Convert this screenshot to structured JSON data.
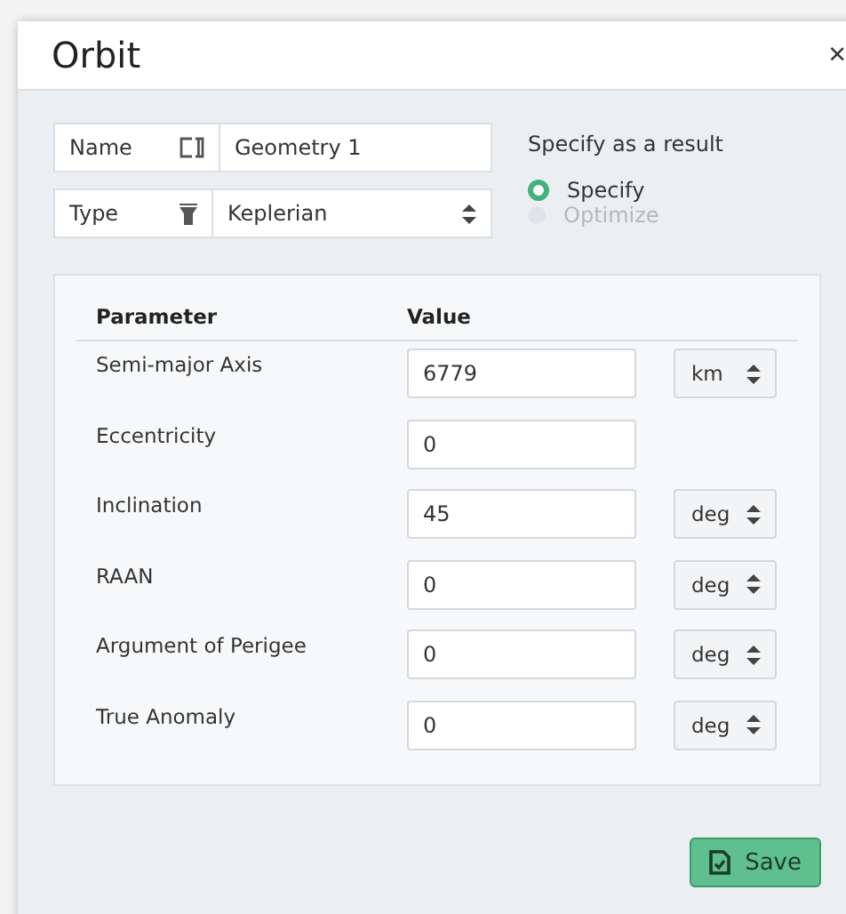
{
  "dialog": {
    "title": "Orbit",
    "close": "×"
  },
  "fields": [
    {
      "label": "Name",
      "kind": "text",
      "value": "Geometry 1"
    },
    {
      "label": "Type",
      "kind": "select",
      "value": "Keplerian"
    }
  ],
  "result": {
    "heading": "Specify as a result",
    "options": [
      {
        "label": "Specify",
        "selected": true,
        "disabled": false
      },
      {
        "label": "Optimize",
        "selected": false,
        "disabled": true
      }
    ]
  },
  "table": {
    "columns": [
      "Parameter",
      "Value"
    ],
    "rows": [
      {
        "parameter": "Semi-major Axis",
        "value": "6779",
        "unit": "km"
      },
      {
        "parameter": "Eccentricity",
        "value": "0"
      },
      {
        "parameter": "Inclination",
        "value": "45",
        "unit": "deg"
      },
      {
        "parameter": "RAAN",
        "value": "0",
        "unit": "deg"
      },
      {
        "parameter": "Argument of Perigee",
        "value": "0",
        "unit": "deg"
      },
      {
        "parameter": "True Anomaly",
        "value": "0",
        "unit": "deg"
      }
    ]
  },
  "save_button": "Save"
}
